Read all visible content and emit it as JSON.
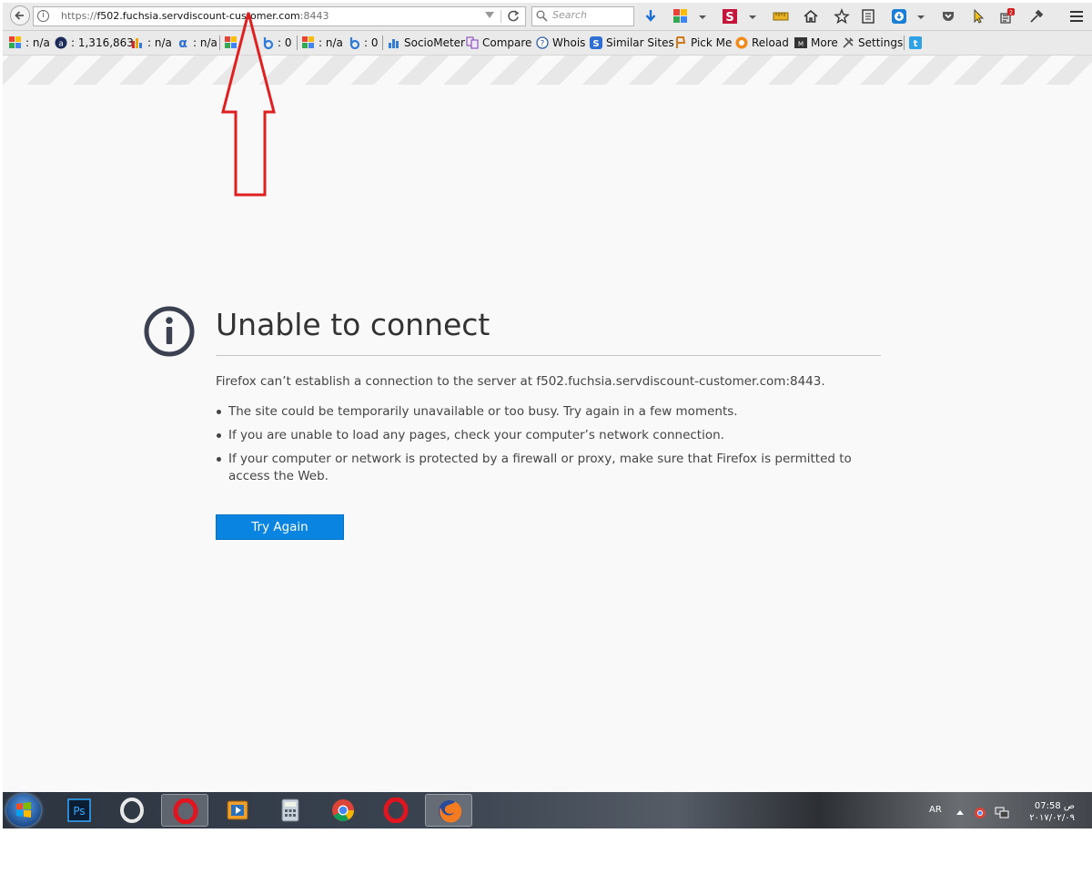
{
  "browser": {
    "url": {
      "scheme": "https://",
      "host": "f502.fuchsia.servdiscount-customer.com",
      "port": ":8443"
    },
    "search_placeholder": "Search"
  },
  "seo_toolbar": {
    "items": [
      {
        "icon": "google-pagerank-icon",
        "label": ": n/a"
      },
      {
        "icon": "alexa-rank-icon",
        "label": ": 1,316,863"
      },
      {
        "icon": "compete-rank-icon",
        "label": ": n/a"
      },
      {
        "icon": "alpha-icon",
        "label": ": n/a"
      },
      {
        "icon": "google-index-icon",
        "label": ": 0"
      },
      {
        "icon": "bing-index-icon",
        "label": ": 0"
      },
      {
        "icon": "google-links-icon",
        "label": ": n/a"
      },
      {
        "icon": "bing-links-icon",
        "label": ": 0"
      },
      {
        "icon": "sociometer-icon",
        "label": "SocioMeter"
      },
      {
        "icon": "compare-icon",
        "label": "Compare"
      },
      {
        "icon": "whois-icon",
        "label": "Whois"
      },
      {
        "icon": "similar-sites-icon",
        "label": "Similar Sites"
      },
      {
        "icon": "pick-me-icon",
        "label": "Pick Me"
      },
      {
        "icon": "reload-icon",
        "label": "Reload"
      },
      {
        "icon": "more-icon",
        "label": "More"
      },
      {
        "icon": "settings-icon",
        "label": "Settings"
      }
    ]
  },
  "error": {
    "title": "Unable to connect",
    "description": "Firefox can’t establish a connection to the server at f502.fuchsia.servdiscount-customer.com:8443.",
    "bullets": [
      "The site could be temporarily unavailable or too busy. Try again in a few moments.",
      "If you are unable to load any pages, check your computer’s network connection.",
      "If your computer or network is protected by a firewall or proxy, make sure that Firefox is permitted to access the Web."
    ],
    "button_label": "Try Again"
  },
  "taskbar": {
    "apps": [
      "photoshop-icon",
      "opera-icon",
      "opera-icon",
      "media-player-icon",
      "calculator-icon",
      "chrome-icon",
      "opera-icon",
      "firefox-icon"
    ],
    "active_app": "firefox-icon",
    "tray": {
      "language": "AR",
      "time": "07:58 ص",
      "date": "٢٠١٧/٠٢/٠٩"
    }
  },
  "colors": {
    "accent_button": "#0a84e1",
    "annotation_arrow": "#e02020",
    "page_background": "#f9f9fa"
  }
}
